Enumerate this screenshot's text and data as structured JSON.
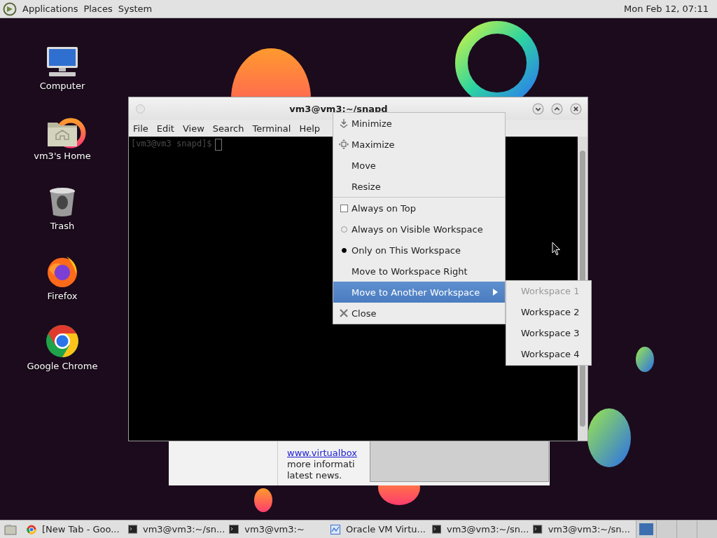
{
  "top_panel": {
    "menus": [
      "Applications",
      "Places",
      "System"
    ],
    "clock": "Mon Feb 12, 07:11"
  },
  "desktop_icons": [
    {
      "label": "Computer",
      "kind": "computer"
    },
    {
      "label": "vm3's Home",
      "kind": "home"
    },
    {
      "label": "Trash",
      "kind": "trash"
    },
    {
      "label": "Firefox",
      "kind": "firefox"
    },
    {
      "label": "Google Chrome",
      "kind": "chrome"
    }
  ],
  "background_window": {
    "lines": [
      {
        "text": "www.virtualbox",
        "kind": "link"
      },
      {
        "text": "more informati",
        "kind": "text"
      },
      {
        "text": "latest news.",
        "kind": "text"
      }
    ]
  },
  "terminal_window": {
    "title": "vm3@vm3:~/snapd",
    "menu": [
      "File",
      "Edit",
      "View",
      "Search",
      "Terminal",
      "Help"
    ],
    "prompt": "[vm3@vm3 snapd]$"
  },
  "context_menu": {
    "items": [
      {
        "label": "Minimize",
        "kind": "minimize",
        "highlighted": false
      },
      {
        "label": "Maximize",
        "kind": "maximize",
        "highlighted": false
      },
      {
        "label": "Move",
        "kind": "plain",
        "highlighted": false
      },
      {
        "label": "Resize",
        "kind": "plain",
        "highlighted": false
      },
      {
        "kind": "separator"
      },
      {
        "label": "Always on Top",
        "kind": "check",
        "checked": false,
        "highlighted": false
      },
      {
        "label": "Always on Visible Workspace",
        "kind": "radio",
        "selected": false,
        "highlighted": false
      },
      {
        "label": "Only on This Workspace",
        "kind": "radio",
        "selected": true,
        "highlighted": false
      },
      {
        "label": "Move to Workspace Right",
        "kind": "plain",
        "highlighted": false
      },
      {
        "label": "Move to Another Workspace",
        "kind": "submenu",
        "highlighted": true
      },
      {
        "label": "Close",
        "kind": "close",
        "highlighted": false
      }
    ]
  },
  "submenu": {
    "items": [
      {
        "label": "Workspace 1",
        "disabled": true
      },
      {
        "label": "Workspace 2",
        "disabled": false
      },
      {
        "label": "Workspace 3",
        "disabled": false
      },
      {
        "label": "Workspace 4",
        "disabled": false
      }
    ]
  },
  "taskbar": {
    "items": [
      {
        "label": "[New Tab - Goo...",
        "kind": "chrome"
      },
      {
        "label": "vm3@vm3:~/sn...",
        "kind": "terminal"
      },
      {
        "label": "vm3@vm3:~",
        "kind": "terminal"
      },
      {
        "label": "Oracle VM Virtu...",
        "kind": "virtualbox"
      },
      {
        "label": "vm3@vm3:~/sn...",
        "kind": "terminal"
      },
      {
        "label": "vm3@vm3:~/sn...",
        "kind": "terminal"
      }
    ],
    "workspaces": [
      {
        "selected": true
      },
      {
        "selected": false
      },
      {
        "selected": false
      },
      {
        "selected": false
      }
    ]
  }
}
